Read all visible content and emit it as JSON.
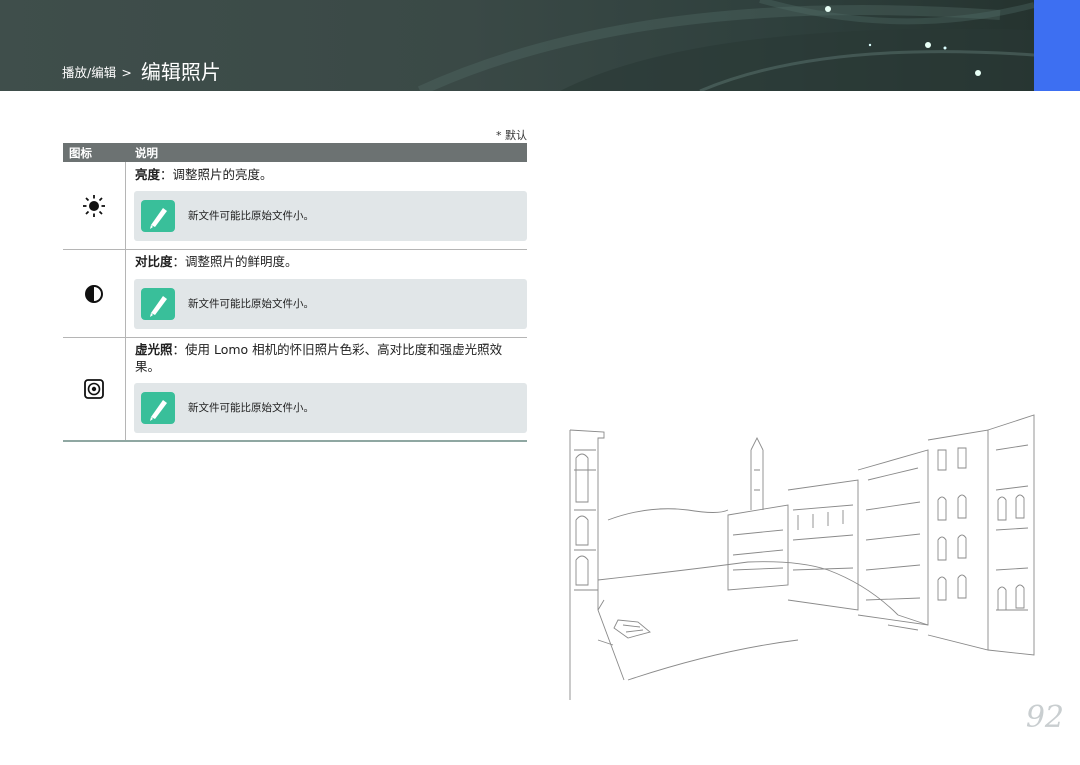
{
  "header": {
    "breadcrumb_parent": "播放/编辑",
    "breadcrumb_separator": ">",
    "title": "编辑照片"
  },
  "table": {
    "default_note": "* 默认",
    "col_icon": "图标",
    "col_desc": "说明",
    "rows": [
      {
        "icon": "brightness-icon",
        "term": "亮度",
        "desc": "：调整照片的亮度。",
        "note": "新文件可能比原始文件小。"
      },
      {
        "icon": "contrast-icon",
        "term": "对比度",
        "desc": "：调整照片的鲜明度。",
        "note": "新文件可能比原始文件小。"
      },
      {
        "icon": "vignetting-icon",
        "term": "虚光照",
        "desc": "：使用 Lomo 相机的怀旧照片色彩、高对比度和强虚光照效果。",
        "note": "新文件可能比原始文件小。"
      }
    ]
  },
  "page_number": "92",
  "colors": {
    "header_bg": "#3a4946",
    "tab_accent": "#3d6ff2",
    "table_header": "#6c7272",
    "note_bg": "#e1e6e8",
    "note_icon": "#39bf9a"
  }
}
